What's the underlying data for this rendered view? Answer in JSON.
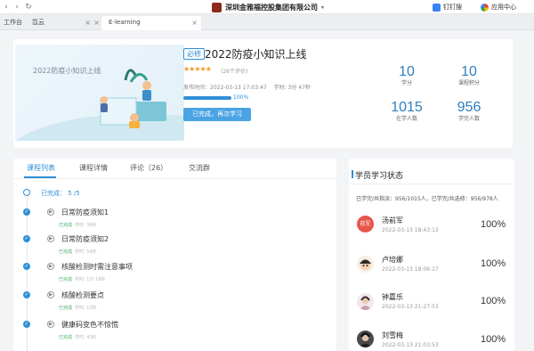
{
  "window": {
    "company_title": "深圳金雅福控股集团有限公司",
    "dingtalk": "钉钉搜",
    "app_center": "应用中心"
  },
  "tabs": [
    {
      "label": "工作台"
    },
    {
      "label": "氙云"
    },
    {
      "label": "E-learning"
    }
  ],
  "course": {
    "cover_title": "2022防疫小知识上线",
    "badge": "必修",
    "title": "2022防疫小知识上线",
    "stars": "★★★★★",
    "reviews": "(26个评价)",
    "publish_time": "发布时间：2022-03-13 17:03:47",
    "duration": "学时: 3分 47秒",
    "progress_label": "100%",
    "progress": 1.0,
    "restudy_button": "已完成，再次学习"
  },
  "stats": [
    {
      "value": "10",
      "label": "学分"
    },
    {
      "value": "10",
      "label": "课程积分"
    },
    {
      "value": "1015",
      "label": "在学人数"
    },
    {
      "value": "956",
      "label": "学完人数"
    }
  ],
  "content_tabs": [
    {
      "label": "课程列表"
    },
    {
      "label": "课程详情"
    },
    {
      "label": "评论（26）"
    },
    {
      "label": "交流群"
    }
  ],
  "done_summary": "已完成： 5 /5",
  "lessons": [
    {
      "title": "日常防疫须知1",
      "status": "已完成",
      "time": "学时: 39秒"
    },
    {
      "title": "日常防疫须知2",
      "status": "已完成",
      "time": "学时: 54秒"
    },
    {
      "title": "核酸检测时需注意事项",
      "status": "已完成",
      "time": "学时: 1分 16秒"
    },
    {
      "title": "核酸检测要点",
      "status": "已完成",
      "time": "学时: 13秒"
    },
    {
      "title": "健康码变色不惊慌",
      "status": "已完成",
      "time": "学时: 43秒"
    }
  ],
  "learners_panel": {
    "title": "学员学习状态",
    "summary": "已学完/共指派：956/1015人，已学完/共选修：956/978人"
  },
  "learners": [
    {
      "avatar_text": "前军",
      "name": "汤前军",
      "time": "2022-03-13 18:43:13",
      "pct": "100%"
    },
    {
      "avatar_text": "",
      "name": "卢培娜",
      "time": "2022-03-13 18:06:17",
      "pct": "100%"
    },
    {
      "avatar_text": "",
      "name": "钟嘉乐",
      "time": "2022-03-13 21:27:53",
      "pct": "100%"
    },
    {
      "avatar_text": "",
      "name": "刘雪梅",
      "time": "2022-03-13 21:03:53",
      "pct": "100%"
    }
  ],
  "colors": {
    "accent": "#2f8fd6",
    "done_green": "#48b06a",
    "star": "#f29a2e"
  }
}
